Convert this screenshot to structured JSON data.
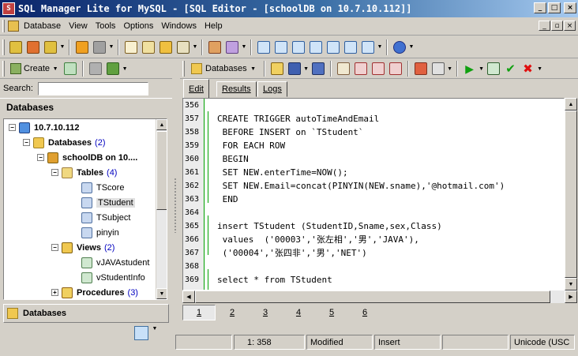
{
  "window": {
    "title": "SQL Manager Lite for MySQL - [SQL Editor - [schoolDB on 10.7.10.112]]",
    "minimize": "_",
    "maximize": "□",
    "close": "×"
  },
  "menu": {
    "items": [
      "Database",
      "View",
      "Tools",
      "Options",
      "Windows",
      "Help"
    ],
    "mdi": {
      "minimize": "_",
      "restore": "▫",
      "close": "×"
    }
  },
  "left_panel": {
    "create_label": "Create",
    "search_label": "Search:",
    "search_value": "",
    "databases_header": "Databases",
    "tree": [
      {
        "label": "10.7.10.112",
        "count": "",
        "expander": "−",
        "icon": "server-icon",
        "bold": true
      },
      {
        "label": "Databases",
        "count": "(2)",
        "expander": "−",
        "icon": "databases-folder-icon",
        "bold": true
      },
      {
        "label": "schoolDB on 10....",
        "count": "",
        "expander": "−",
        "icon": "database-icon",
        "bold": true
      },
      {
        "label": "Tables",
        "count": "(4)",
        "expander": "−",
        "icon": "tables-folder-icon",
        "bold": true
      },
      {
        "label": "TScore",
        "count": "",
        "expander": "",
        "icon": "table-icon",
        "bold": false
      },
      {
        "label": "TStudent",
        "count": "",
        "expander": "",
        "icon": "table-icon",
        "bold": false,
        "selected": true
      },
      {
        "label": "TSubject",
        "count": "",
        "expander": "",
        "icon": "table-icon",
        "bold": false
      },
      {
        "label": "pinyin",
        "count": "",
        "expander": "",
        "icon": "table-icon",
        "bold": false
      },
      {
        "label": "Views",
        "count": "(2)",
        "expander": "−",
        "icon": "views-folder-icon",
        "bold": true
      },
      {
        "label": "vJAVAstudent",
        "count": "",
        "expander": "",
        "icon": "view-icon",
        "bold": false
      },
      {
        "label": "vStudentInfo",
        "count": "",
        "expander": "",
        "icon": "view-icon",
        "bold": false
      },
      {
        "label": "Procedures",
        "count": "(3)",
        "expander": "+",
        "icon": "procedures-folder-icon",
        "bold": true
      }
    ],
    "bottom_label": "Databases"
  },
  "right_panel": {
    "db_button_label": "Databases",
    "tabs": [
      "Edit",
      "Results",
      "Logs"
    ],
    "active_tab": "Edit",
    "line_numbers": [
      "356",
      "357",
      "358",
      "359",
      "360",
      "361",
      "362",
      "363",
      "364",
      "365",
      "366",
      "367",
      "368",
      "369"
    ],
    "code_lines": [
      "",
      "CREATE TRIGGER autoTimeAndEmail",
      " BEFORE INSERT on `TStudent`",
      " FOR EACH ROW",
      " BEGIN",
      " SET NEW.enterTime=NOW();",
      " SET NEW.Email=concat(PINYIN(NEW.sname),'@hotmail.com')",
      " END",
      "",
      "insert TStudent (StudentID,Sname,sex,Class)",
      " values  ('00003','张左相','男','JAVA'),",
      " ('00004','张四非','男','NET')",
      "",
      "select * from TStudent"
    ],
    "page_tabs": [
      "1",
      "2",
      "3",
      "4",
      "5",
      "6"
    ],
    "active_page": "1"
  },
  "status": {
    "position": "1:  358",
    "modified": "Modified",
    "mode": "Insert",
    "encoding": "Unicode (USC"
  },
  "colors": {
    "title_gradient_start": "#0a246a",
    "title_gradient_end": "#a6caf0",
    "gutter_marker": "#00a000",
    "count_text": "#0000c0"
  }
}
